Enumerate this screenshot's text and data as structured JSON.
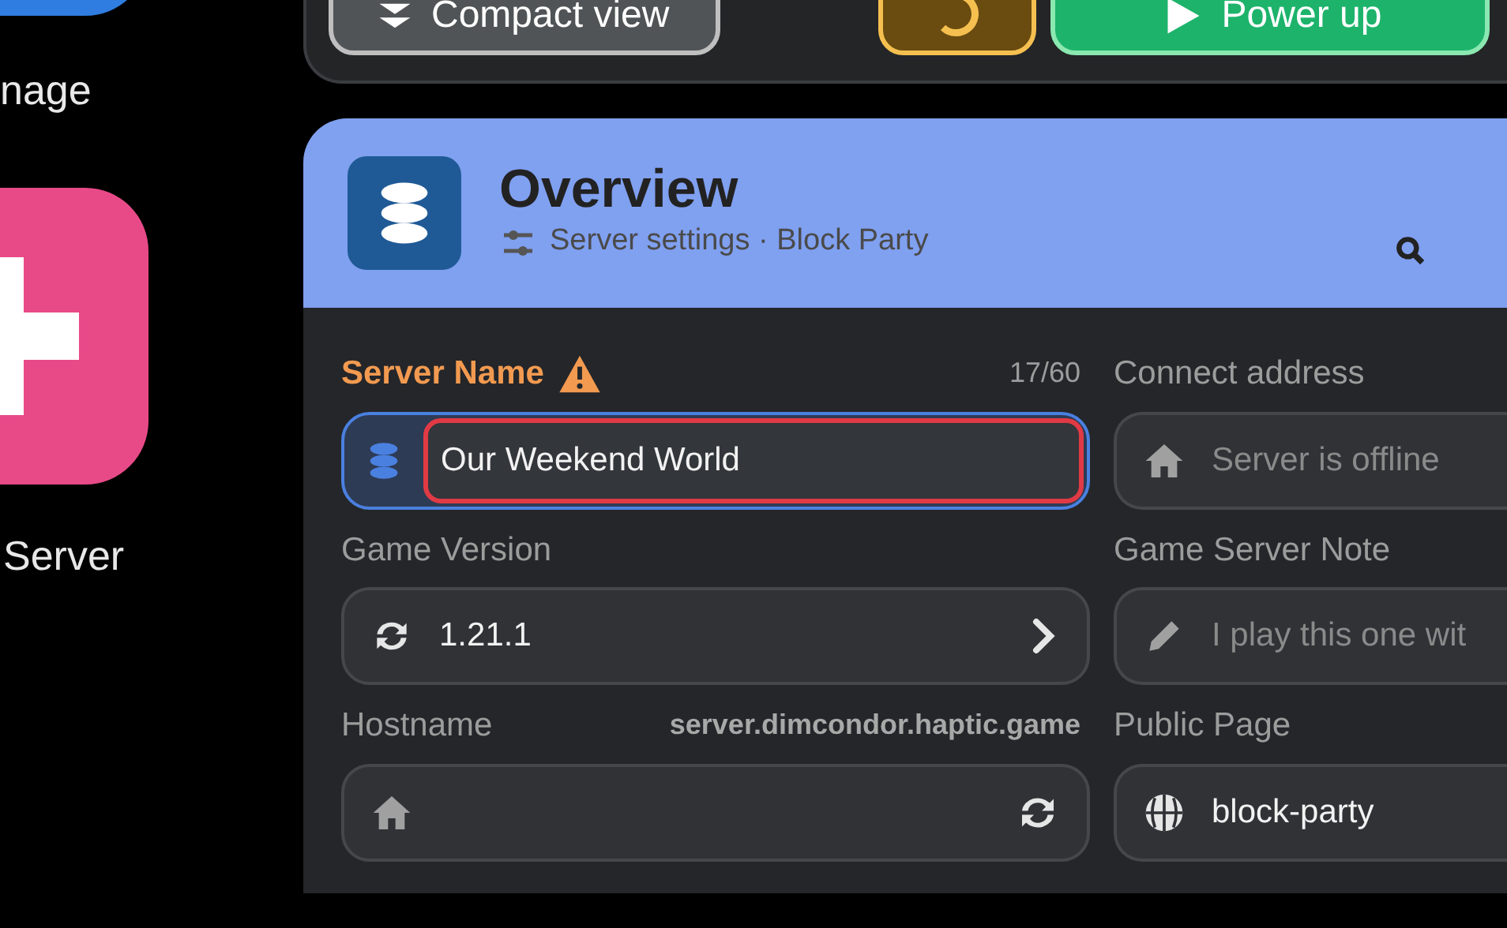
{
  "sidebar": {
    "items": [
      {
        "label": "nage",
        "color": "#2f7de0"
      },
      {
        "label": "Server",
        "color": "#e84a88"
      }
    ]
  },
  "toolbar": {
    "buttons": [
      {
        "label": "Compact view",
        "kind": "compact"
      },
      {
        "kind": "history"
      },
      {
        "label": "Power up",
        "kind": "power"
      }
    ]
  },
  "panel": {
    "title": "Overview",
    "subtitle": "Server settings · Block Party",
    "fields": [
      {
        "label": "Server Name",
        "warning": true,
        "counter": "17/60",
        "value": "Our Weekend World",
        "focused": true,
        "invalid": true,
        "kind": "name"
      },
      {
        "label": "Connect address",
        "placeholder": "Server is offline",
        "kind": "address"
      },
      {
        "label": "Game Version",
        "value": "1.21.1",
        "kind": "version"
      },
      {
        "label": "Game Server Note",
        "placeholder": "I play this one wit",
        "kind": "note"
      },
      {
        "label": "Hostname",
        "aside": "server.dimcondor.haptic.game",
        "kind": "hostname"
      },
      {
        "label": "Public Page",
        "value": "block-party",
        "kind": "page"
      }
    ]
  }
}
